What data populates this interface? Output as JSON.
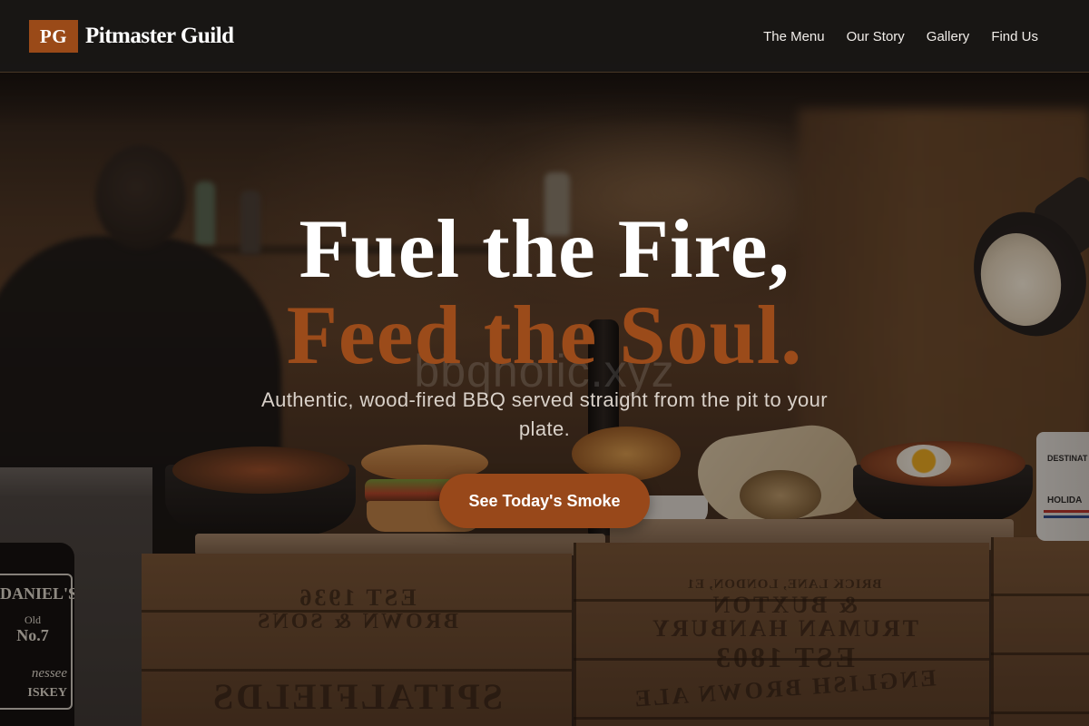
{
  "brand": {
    "initials": "PG",
    "name": "Pitmaster Guild"
  },
  "nav": {
    "items": [
      {
        "label": "The Menu"
      },
      {
        "label": "Our Story"
      },
      {
        "label": "Gallery"
      },
      {
        "label": "Find Us"
      }
    ]
  },
  "hero": {
    "headline_line1": "Fuel the Fire,",
    "headline_line2": "Feed the Soul.",
    "subtitle": "Authentic, wood-fired BBQ served straight from the pit to your plate.",
    "cta_label": "See Today's Smoke"
  },
  "photo": {
    "watermark": "bbqholic.xyz",
    "crate_left": [
      "EST 1936",
      "BROWN & SONS",
      "SPITALFIELDS"
    ],
    "crate_middle": [
      "BRICK LANE, LONDON, E1",
      "& BUXTON",
      "TRUMAN HANBURY",
      "EST 1803",
      "ENGLISH BROWN ALE"
    ],
    "bottle_label": [
      "DANIEL'S",
      "Old",
      "No.7",
      "nessee",
      "ISKEY"
    ],
    "mug": [
      "DESTINAT",
      "HOLIDA"
    ]
  },
  "colors": {
    "accent": "#9a4a18",
    "nav_background": "#181615",
    "headline_primary": "#ffffff",
    "headline_accent": "#9b4b1a",
    "subtitle": "#d9d1c9"
  }
}
